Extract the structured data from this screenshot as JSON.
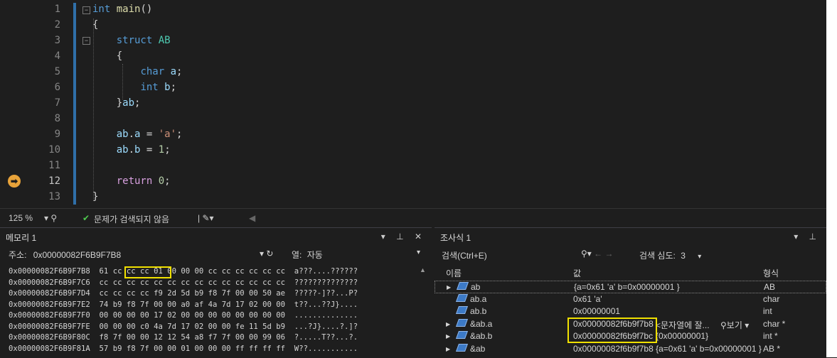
{
  "editor": {
    "lines": [
      {
        "num": "1",
        "html": "<span class=\"kw\">int</span> <span class=\"fn\">main</span>()"
      },
      {
        "num": "2",
        "html": "{"
      },
      {
        "num": "3",
        "html": "    <span class=\"kw\">struct</span> <span class=\"type\">AB</span>"
      },
      {
        "num": "4",
        "html": "    {"
      },
      {
        "num": "5",
        "html": "        <span class=\"kw\">char</span> <span class=\"var\">a</span>;"
      },
      {
        "num": "6",
        "html": "        <span class=\"kw\">int</span> <span class=\"var\">b</span>;"
      },
      {
        "num": "7",
        "html": "    }<span class=\"var\">ab</span>;"
      },
      {
        "num": "8",
        "html": ""
      },
      {
        "num": "9",
        "html": "    <span class=\"var\">ab</span>.<span class=\"var\">a</span> = <span class=\"str\">'a'</span>;"
      },
      {
        "num": "10",
        "html": "    <span class=\"var\">ab</span>.<span class=\"var\">b</span> = <span class=\"num\">1</span>;"
      },
      {
        "num": "11",
        "html": ""
      },
      {
        "num": "12",
        "html": "    <span class=\"kw2\">return</span> <span class=\"num\">0</span>;"
      },
      {
        "num": "13",
        "html": "}"
      }
    ]
  },
  "status": {
    "zoom": "125 %",
    "issues": "문제가 검색되지 않음"
  },
  "memory": {
    "title": "메모리 1",
    "address_label": "주소:",
    "address_value": "0x00000082F6B9F7B8",
    "columns_label": "열:",
    "columns_value": "자동",
    "rows": [
      {
        "addr": "0x00000082F6B9F7B8",
        "bytes": "61 cc cc cc 01 00 00 00 cc cc cc cc cc cc",
        "ascii": "a???....??????"
      },
      {
        "addr": "0x00000082F6B9F7C6",
        "bytes": "cc cc cc cc cc cc cc cc cc cc cc cc cc cc",
        "ascii": "??????????????"
      },
      {
        "addr": "0x00000082F6B9F7D4",
        "bytes": "cc cc cc cc f9 2d 5d b9 f8 7f 00 00 50 ae",
        "ascii": "?????-]??...P?"
      },
      {
        "addr": "0x00000082F6B9F7E2",
        "bytes": "74 b9 f8 7f 00 00 a0 af 4a 7d 17 02 00 00",
        "ascii": "t??...??J}...."
      },
      {
        "addr": "0x00000082F6B9F7F0",
        "bytes": "00 00 00 00 17 02 00 00 00 00 00 00 00 00",
        "ascii": ".............."
      },
      {
        "addr": "0x00000082F6B9F7FE",
        "bytes": "00 00 00 c0 4a 7d 17 02 00 00 fe 11 5d b9",
        "ascii": "...?J}....?.]?"
      },
      {
        "addr": "0x00000082F6B9F80C",
        "bytes": "f8 7f 00 00 12 12 54 a8 f7 7f 00 00 99 06",
        "ascii": "?.....T??...?."
      },
      {
        "addr": "0x00000082F6B9F81A",
        "bytes": "57 b9 f8 7f 00 00 01 00 00 00 ff ff ff ff",
        "ascii": "W??..........."
      }
    ]
  },
  "watch": {
    "title": "조사식 1",
    "search_placeholder": "검색(Ctrl+E)",
    "depth_label": "검색 심도:",
    "depth_value": "3",
    "col_name": "이름",
    "col_value": "값",
    "col_type": "형식",
    "rows": [
      {
        "expand": true,
        "name": "ab",
        "value": "{a=0x61 'a' b=0x00000001 }",
        "type": "AB"
      },
      {
        "expand": false,
        "name": "ab.a",
        "value": "0x61 'a'",
        "type": "char"
      },
      {
        "expand": false,
        "name": "ab.b",
        "value": "0x00000001",
        "type": "int"
      },
      {
        "expand": true,
        "name": "&ab.a",
        "value": "0x00000082f6b9f7b8",
        "extra": "<문자열에 잘...",
        "view": "보기",
        "type": "char *"
      },
      {
        "expand": true,
        "name": "&ab.b",
        "value": "0x00000082f6b9f7bc",
        "extra": "{0x00000001}",
        "type": "int *"
      },
      {
        "expand": true,
        "name": "&ab",
        "value": "0x00000082f6b9f7b8 {a=0x61 'a' b=0x00000001 }",
        "type": "AB *"
      }
    ]
  },
  "colors": {
    "highlight": "#f0e000",
    "accent": "#2f6fa8"
  }
}
